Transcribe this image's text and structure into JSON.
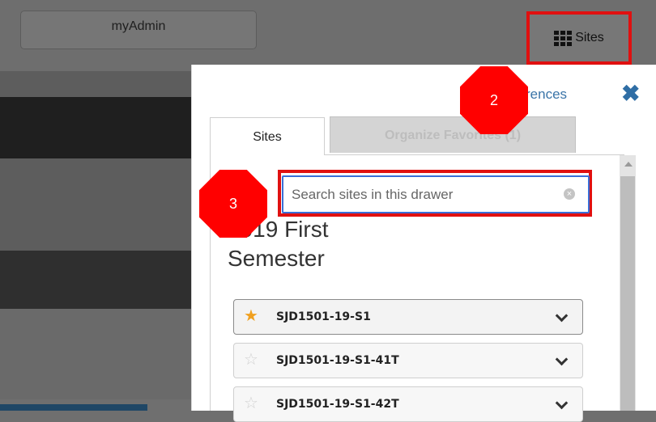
{
  "header": {
    "myadmin_label": "myAdmin",
    "sites_label": "Sites"
  },
  "drawer": {
    "preferences_link": "rences",
    "tabs": [
      {
        "label": "Sites"
      },
      {
        "label": "Organize Favorites (1)"
      }
    ],
    "search": {
      "placeholder": "Search sites in this drawer",
      "value": ""
    },
    "term_title": "2019 First Semester",
    "sites": [
      {
        "name": "SJD1501-19-S1",
        "favorite": true
      },
      {
        "name": "SJD1501-19-S1-41T",
        "favorite": false
      },
      {
        "name": "SJD1501-19-S1-42T",
        "favorite": false
      }
    ]
  },
  "annotations": [
    {
      "label": "2"
    },
    {
      "label": "3"
    }
  ],
  "colors": {
    "highlight": "#e01010",
    "badge": "#ff0000",
    "link": "#3a74a8",
    "star": "#f0a020"
  }
}
